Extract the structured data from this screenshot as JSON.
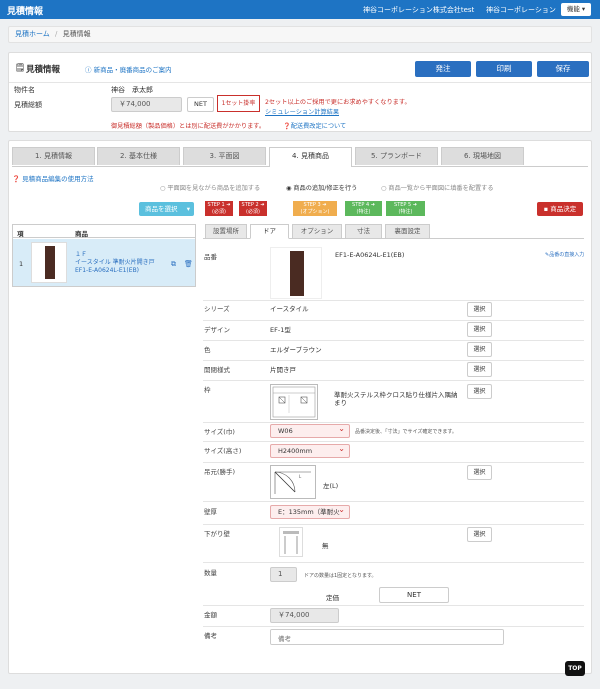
{
  "nav": {
    "brand": "見積情報",
    "company": "神谷コーポレーション株式会社test",
    "company2": "神谷コーポレーション",
    "func": "機能 ▾"
  },
  "breadcrumb": {
    "home": "見積ホーム",
    "sep": "/",
    "current": "見積情報"
  },
  "estimate": {
    "title": "見積情報",
    "new_product_link": "新商品・廃番商品のご案内",
    "btn_order": "発注",
    "btn_print": "印刷",
    "btn_save": "保存",
    "property_label": "物件名",
    "property_value": "神谷　承太郎",
    "total_label": "見積総額",
    "total_value": "￥74,000",
    "net_label": "NET",
    "set_badge": "1セット掛率",
    "set_note": "2セット以上のご採用で更にお求めやすくなります。",
    "sim_link": "シミュレーション計算結果",
    "shipping_note": "御見積総額（製品価格）とは別に配送費がかかります。",
    "shipping_link": "配送費改定について"
  },
  "tabs": [
    "1. 見積情報",
    "2. 基本仕様",
    "3. 平面図",
    "4. 見積商品",
    "5. プランボード",
    "6. 現場地図"
  ],
  "howto": "見積商品編集の使用方法",
  "radios": [
    "平面図を見ながら商品を追加する",
    "商品の追加/修正を行う",
    "商品一覧から平面図に填番を配置する"
  ],
  "select_product": "商品を選択",
  "steps": [
    {
      "l1": "STEP 1 ➜",
      "l2": "(必須)"
    },
    {
      "l1": "STEP 2 ➜",
      "l2": "(必須)"
    },
    {
      "l1": "STEP 3 ➜",
      "l2": "(オプション)"
    },
    {
      "l1": "STEP 4 ➜",
      "l2": "(特注)"
    },
    {
      "l1": "STEP 5 ➜",
      "l2": "(特注)"
    }
  ],
  "decide": "商品決定",
  "list": {
    "col_no": "項",
    "col_product": "商品",
    "row_no": "1",
    "row_line1": "１Ｆ",
    "row_line2": "イースタイル 準耐火片開き戸",
    "row_line3": "EF1-E-A0624L-E1(EB)"
  },
  "subtabs": [
    "設置場所",
    "ドア",
    "オプション",
    "寸法",
    "裏面設定"
  ],
  "detail": {
    "product_label": "品番",
    "product_code": "EF1-E-A0624L-E1(EB)",
    "direct_input": "品番の直接入力",
    "series_label": "シリーズ",
    "series_value": "イースタイル",
    "design_label": "デザイン",
    "design_value": "EF-1型",
    "color_label": "色",
    "color_value": "エルダーブラウン",
    "open_label": "開閉様式",
    "open_value": "片開き戸",
    "frame_label": "枠",
    "frame_value": "準耐火ステルス枠クロス貼り仕様片入隅納まり",
    "w_label": "サイズ(巾)",
    "w_value": "W06",
    "w_note": "品番決定後、「寸法」でサイズ確定できます。",
    "h_label": "サイズ(高さ)",
    "h_value": "H2400mm",
    "hinge_label": "吊元(勝手)",
    "hinge_value": "左(L)",
    "wall_label": "壁厚",
    "wall_value": "E：135mm（準耐火",
    "drop_label": "下がり壁",
    "drop_value": "無",
    "qty_label": "数量",
    "qty_value": "1",
    "qty_note": "ドアの数量は1固定となります。",
    "price_type": "定価",
    "net": "NET",
    "amount_label": "金額",
    "amount_value": "￥74,000",
    "remark_label": "備考",
    "remark_placeholder": "備考",
    "select": "選択"
  },
  "top": "TOP",
  "colors": {
    "primary": "#2a6fc0",
    "red": "#c9302c",
    "orange": "#f0ad4e",
    "green": "#5cb85c"
  }
}
